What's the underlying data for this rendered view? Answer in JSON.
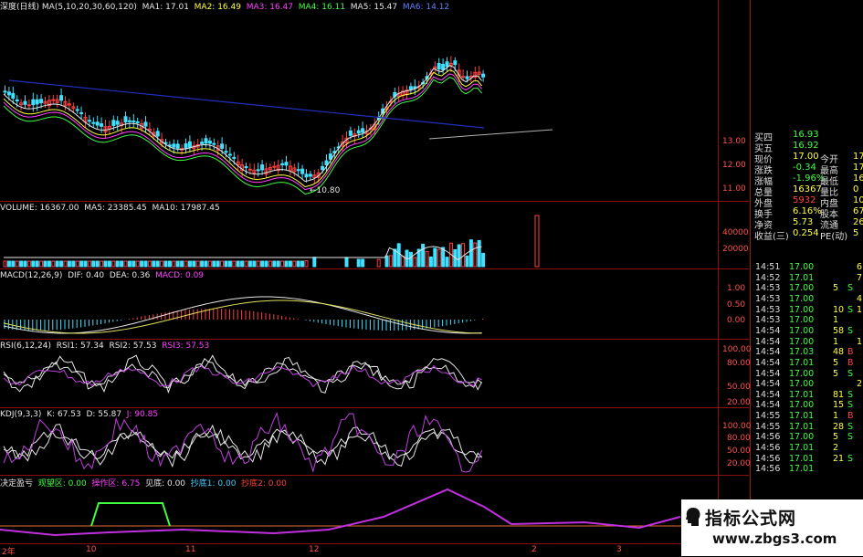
{
  "main_header": {
    "name": "深度(日线)",
    "ma_label": "MA(5,10,20,30,60,120)",
    "ma1": "MA1: 17.01",
    "ma2": "MA2: 16.49",
    "ma3": "MA3: 16.47",
    "ma4": "MA4: 16.11",
    "ma5": "MA5: 15.47",
    "ma6": "MA6: 14.12"
  },
  "price_axis": [
    "13.00",
    "12.00",
    "11.00"
  ],
  "low_marker": "←10.80",
  "volume_header": {
    "label": "VOLUME: 16367.00",
    "ma5": "MA5: 23385.45",
    "ma10": "MA10: 17987.45"
  },
  "volume_axis": [
    "40000",
    "20000"
  ],
  "macd_header": {
    "label": "MACD(12,26,9)",
    "dif": "DIF: 0.40",
    "dea": "DEA: 0.36",
    "macd": "MACD: 0.09"
  },
  "macd_axis": [
    "1.00",
    "0.50",
    "0.00"
  ],
  "rsi_header": {
    "label": "RSI(6,12,24)",
    "rsi1": "RSI1: 57.34",
    "rsi2": "RSI2: 57.53",
    "rsi3": "RSI3: 57.53"
  },
  "rsi_axis": [
    "100.00",
    "80.00",
    "50.00",
    "20.00"
  ],
  "kdj_header": {
    "label": "KDJ(9,3,3)",
    "k": "K: 67.53",
    "d": "D: 55.87",
    "j": "J: 90.85"
  },
  "kdj_axis": [
    "100.00",
    "80.00",
    "50.00",
    "20.00"
  ],
  "signal_header": {
    "label": "决定盈亏",
    "a": "观望区: 0.00",
    "b": "操作区: 6.75",
    "c": "见底: 0.00",
    "d": "抄底1: 0.00",
    "e": "抄底2: 0.00"
  },
  "date_axis": [
    "2年",
    "10",
    "11",
    "12",
    "2",
    "3"
  ],
  "quote_panel": {
    "rows": [
      {
        "label": "买四",
        "value": "16.93",
        "extra1": "",
        "extra2": ""
      },
      {
        "label": "买五",
        "value": "16.92",
        "extra1": "",
        "extra2": ""
      },
      {
        "label": "现价",
        "value": "17.00",
        "extra1": "今开",
        "extra2": "17"
      },
      {
        "label": "涨跌",
        "value": "-0.34",
        "extra1": "最高",
        "extra2": "17"
      },
      {
        "label": "涨幅",
        "value": "-1.96%",
        "extra1": "最低",
        "extra2": "16"
      },
      {
        "label": "总量",
        "value": "16367",
        "extra1": "量比",
        "extra2": "0"
      },
      {
        "label": "外盘",
        "value": "5932",
        "extra1": "内盘",
        "extra2": "10"
      },
      {
        "label": "换手",
        "value": "6.16%",
        "extra1": "股本",
        "extra2": "676"
      },
      {
        "label": "净资",
        "value": "5.73",
        "extra1": "流通",
        "extra2": "265"
      },
      {
        "label": "收益(三)",
        "value": "0.254",
        "extra1": "PE(动)",
        "extra2": "5"
      }
    ]
  },
  "ticks": [
    {
      "time": "14:51",
      "price": "17.00",
      "vol": "",
      "side": "",
      "extra": "6"
    },
    {
      "time": "14:52",
      "price": "17.01",
      "vol": "",
      "side": "",
      "extra": "7"
    },
    {
      "time": "14:53",
      "price": "17.00",
      "vol": "5",
      "side": "S",
      "extra": ""
    },
    {
      "time": "14:53",
      "price": "17.00",
      "vol": "",
      "side": "",
      "extra": "4"
    },
    {
      "time": "14:53",
      "price": "17.00",
      "vol": "10",
      "side": "S",
      "extra": "1"
    },
    {
      "time": "14:53",
      "price": "17.00",
      "vol": "1",
      "side": "",
      "extra": ""
    },
    {
      "time": "14:54",
      "price": "17.00",
      "vol": "58",
      "side": "S",
      "extra": ""
    },
    {
      "time": "14:54",
      "price": "17.00",
      "vol": "1",
      "side": "",
      "extra": "1"
    },
    {
      "time": "14:54",
      "price": "17.03",
      "vol": "48",
      "side": "B",
      "extra": ""
    },
    {
      "time": "14:54",
      "price": "17.01",
      "vol": "5",
      "side": "B",
      "extra": ""
    },
    {
      "time": "14:54",
      "price": "17.00",
      "vol": "5",
      "side": "S",
      "extra": ""
    },
    {
      "time": "14:54",
      "price": "17.00",
      "vol": "",
      "side": "",
      "extra": "2"
    },
    {
      "time": "14:54",
      "price": "17.01",
      "vol": "81",
      "side": "S",
      "extra": ""
    },
    {
      "time": "14:54",
      "price": "17.00",
      "vol": "15",
      "side": "S",
      "extra": ""
    },
    {
      "time": "14:55",
      "price": "17.01",
      "vol": "1",
      "side": "B",
      "extra": ""
    },
    {
      "time": "14:55",
      "price": "17.01",
      "vol": "28",
      "side": "S",
      "extra": ""
    },
    {
      "time": "14:56",
      "price": "17.00",
      "vol": "5",
      "side": "S",
      "extra": ""
    },
    {
      "time": "14:56",
      "price": "17.01",
      "vol": "2",
      "side": "",
      "extra": ""
    },
    {
      "time": "14:56",
      "price": "17.01",
      "vol": "21",
      "side": "S",
      "extra": ""
    },
    {
      "time": "14:56",
      "price": "17.01",
      "vol": "",
      "side": "",
      "extra": ""
    }
  ],
  "watermark": {
    "title": "指标公式网",
    "url": "www.zbgs3.com"
  },
  "colors": {
    "up": "#ff4040",
    "down": "#40e0ff",
    "grid": "#8a1010",
    "ma_blue": "#2030c0",
    "signal_green": "#40ff40",
    "signal_purple": "#c030e0"
  }
}
